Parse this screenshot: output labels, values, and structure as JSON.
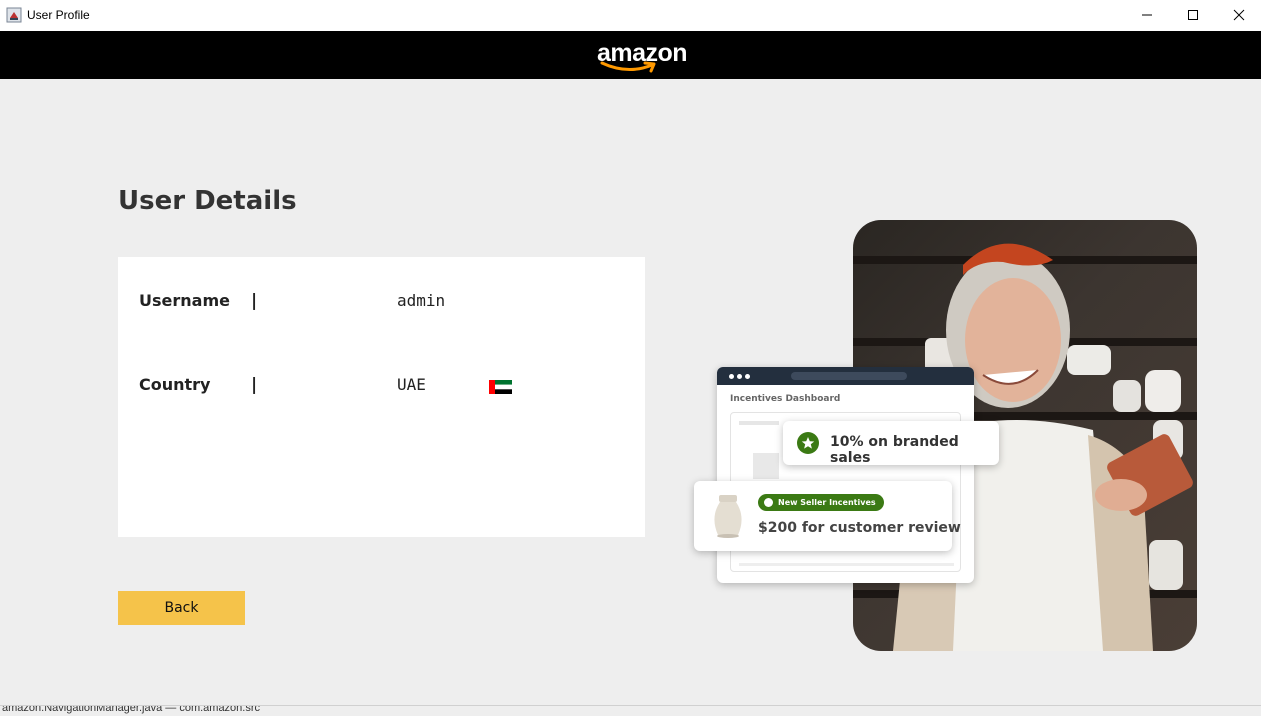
{
  "window": {
    "title": "User Profile",
    "app_icon": "java-cup-icon",
    "controls": [
      "minimize-icon",
      "maximize-icon",
      "close-icon"
    ]
  },
  "header": {
    "logo_text": "amazon",
    "background": "#000000"
  },
  "page": {
    "title": "User Details",
    "fields": [
      {
        "label": "Username",
        "separator": "|",
        "value": "admin"
      },
      {
        "label": "Country",
        "separator": "|",
        "value": "UAE",
        "icon": "uae-flag-icon"
      }
    ],
    "back_label": "Back",
    "back_color": "#f5c34a"
  },
  "illustration": {
    "dashboard_title": "Incentives Dashboard",
    "badge_text": "10% on branded sales",
    "pill_text": "New Seller Incentives",
    "incentive_text": "$200 for customer review",
    "accent": "#3b7a14"
  },
  "statusbar": {
    "text": "amazon.NavigationManager.java — com.amazon.src"
  }
}
